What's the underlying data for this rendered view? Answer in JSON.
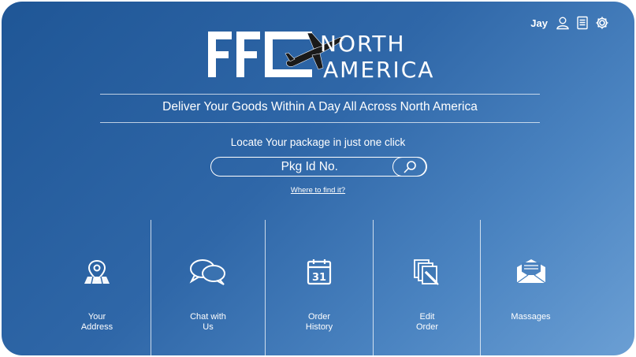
{
  "header": {
    "user_name": "Jay",
    "icons": [
      "user-icon",
      "document-icon",
      "gear-icon"
    ]
  },
  "logo": {
    "mark": "FFC",
    "line1": "NORTH",
    "line2": "AMERICA"
  },
  "tagline": "Deliver Your Goods Within A Day All Across North America",
  "locate": {
    "prompt": "Locate Your package in just one click",
    "placeholder": "Pkg Id No.",
    "value": "",
    "help_link": "Where to find it?"
  },
  "tiles": [
    {
      "label": "Your\nAddress",
      "icon": "map-pin-icon"
    },
    {
      "label": "Chat with\nUs",
      "icon": "chat-bubbles-icon"
    },
    {
      "label": "Order\nHistory",
      "icon": "calendar-icon"
    },
    {
      "label": "Edit\nOrder",
      "icon": "edit-documents-icon"
    },
    {
      "label": "Massages",
      "icon": "envelope-icon"
    }
  ],
  "colors": {
    "background_start": "#1f5696",
    "background_end": "#6b9fd4",
    "foreground": "#ffffff"
  }
}
